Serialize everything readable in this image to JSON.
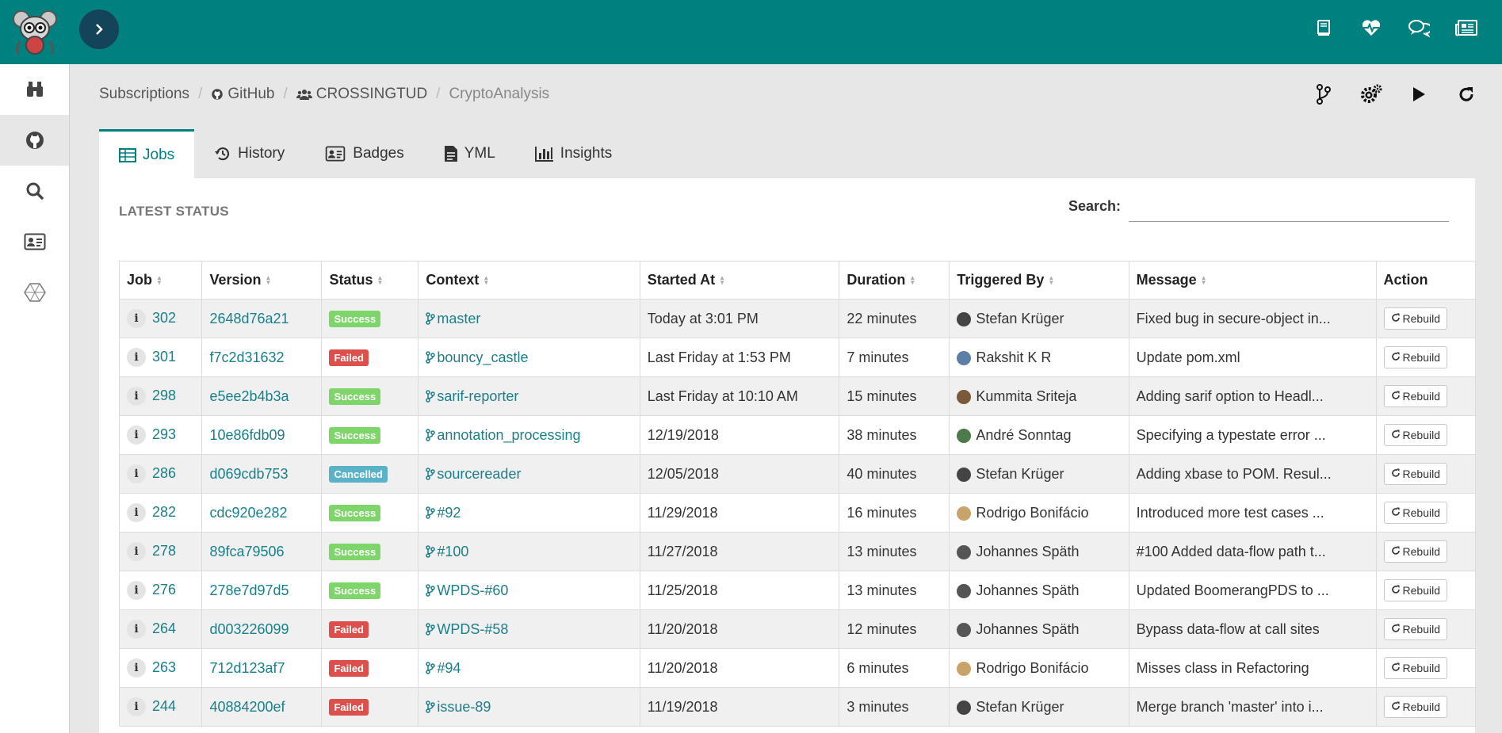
{
  "breadcrumb": [
    "Subscriptions",
    "GitHub",
    "CROSSINGTUD",
    "CryptoAnalysis"
  ],
  "tabs": [
    {
      "label": "Jobs",
      "icon": "table-icon"
    },
    {
      "label": "History",
      "icon": "history-icon"
    },
    {
      "label": "Badges",
      "icon": "id-card-icon"
    },
    {
      "label": "YML",
      "icon": "file-icon"
    },
    {
      "label": "Insights",
      "icon": "bar-chart-icon"
    }
  ],
  "panel": {
    "title": "LATEST STATUS",
    "search_label": "Search:",
    "search_value": ""
  },
  "table": {
    "headers": [
      "Job",
      "Version",
      "Status",
      "Context",
      "Started At",
      "Duration",
      "Triggered By",
      "Message",
      "Action"
    ],
    "action_label": "Rebuild",
    "rows": [
      {
        "job": "302",
        "version": "2648d76a21",
        "status": "Success",
        "context": "master",
        "started": "Today at 3:01 PM",
        "duration": "22 minutes",
        "by": "Stefan Krüger",
        "message": "Fixed bug in secure-object in..."
      },
      {
        "job": "301",
        "version": "f7c2d31632",
        "status": "Failed",
        "context": "bouncy_castle",
        "started": "Last Friday at 1:53 PM",
        "duration": "7 minutes",
        "by": "Rakshit K R",
        "message": "Update pom.xml"
      },
      {
        "job": "298",
        "version": "e5ee2b4b3a",
        "status": "Success",
        "context": "sarif-reporter",
        "started": "Last Friday at 10:10 AM",
        "duration": "15 minutes",
        "by": "Kummita Sriteja",
        "message": "Adding sarif option to Headl..."
      },
      {
        "job": "293",
        "version": "10e86fdb09",
        "status": "Success",
        "context": "annotation_processing",
        "started": "12/19/2018",
        "duration": "38 minutes",
        "by": "André Sonntag",
        "message": "Specifying a typestate error ..."
      },
      {
        "job": "286",
        "version": "d069cdb753",
        "status": "Cancelled",
        "context": "sourcereader",
        "started": "12/05/2018",
        "duration": "40 minutes",
        "by": "Stefan Krüger",
        "message": "Adding xbase to POM. Resul..."
      },
      {
        "job": "282",
        "version": "cdc920e282",
        "status": "Success",
        "context": "#92",
        "started": "11/29/2018",
        "duration": "16 minutes",
        "by": "Rodrigo Bonifácio",
        "message": "Introduced more test cases ..."
      },
      {
        "job": "278",
        "version": "89fca79506",
        "status": "Success",
        "context": "#100",
        "started": "11/27/2018",
        "duration": "13 minutes",
        "by": "Johannes Späth",
        "message": "#100 Added data-flow path t..."
      },
      {
        "job": "276",
        "version": "278e7d97d5",
        "status": "Success",
        "context": "WPDS-#60",
        "started": "11/25/2018",
        "duration": "13 minutes",
        "by": "Johannes Späth",
        "message": "Updated BoomerangPDS to ..."
      },
      {
        "job": "264",
        "version": "d003226099",
        "status": "Failed",
        "context": "WPDS-#58",
        "started": "11/20/2018",
        "duration": "12 minutes",
        "by": "Johannes Späth",
        "message": "Bypass data-flow at call sites"
      },
      {
        "job": "263",
        "version": "712d123af7",
        "status": "Failed",
        "context": "#94",
        "started": "11/20/2018",
        "duration": "6 minutes",
        "by": "Rodrigo Bonifácio",
        "message": "Misses class in Refactoring"
      },
      {
        "job": "244",
        "version": "40884200ef",
        "status": "Failed",
        "context": "issue-89",
        "started": "11/19/2018",
        "duration": "3 minutes",
        "by": "Stefan Krüger",
        "message": "Merge branch 'master' into i..."
      }
    ]
  },
  "icons": {
    "top": [
      "book-icon",
      "heartbeat-icon",
      "comments-icon",
      "newspaper-icon"
    ],
    "sidebar": [
      "binoculars-icon",
      "github-icon",
      "search-icon",
      "id-card-icon",
      "hexagon-icon"
    ],
    "actions": [
      "branch-icon",
      "cogs-icon",
      "play-icon",
      "refresh-icon"
    ]
  },
  "colors": {
    "brand": "#00807f",
    "toggle": "#14445a",
    "success": "#7ed66a",
    "failed": "#dd4f4a",
    "cancelled": "#5ab2c9",
    "link": "#1b7f8a"
  }
}
